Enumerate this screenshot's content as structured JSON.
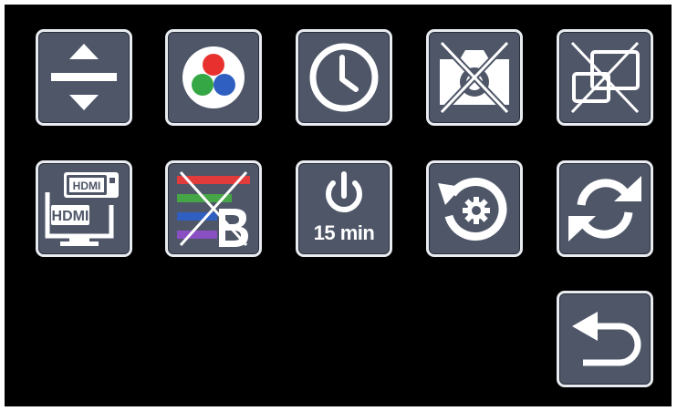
{
  "screen": {
    "background": "#000000",
    "tile_color": "#4e5668",
    "tile_border_color": "#e8ebf0"
  },
  "buttons": [
    {
      "icon": "up-down-arrows-icon"
    },
    {
      "icon": "rgb-color-circles-icon",
      "colors": [
        "#e8312e",
        "#35a845",
        "#2f5fc1"
      ]
    },
    {
      "icon": "clock-icon"
    },
    {
      "icon": "camera-crossed-icon"
    },
    {
      "icon": "screens-crossed-icon"
    },
    {
      "icon": "hdmi-input-icon",
      "labels": [
        "HDMI",
        "HDMI"
      ]
    },
    {
      "icon": "color-bars-crossed-icon",
      "colors": [
        "#e23b3b",
        "#46a546",
        "#2f5fc1",
        "#8a4fc2"
      ]
    },
    {
      "icon": "power-timer-icon",
      "label": "15 min"
    },
    {
      "icon": "reset-settings-icon"
    },
    {
      "icon": "refresh-icon"
    },
    {
      "icon": "back-icon"
    }
  ]
}
